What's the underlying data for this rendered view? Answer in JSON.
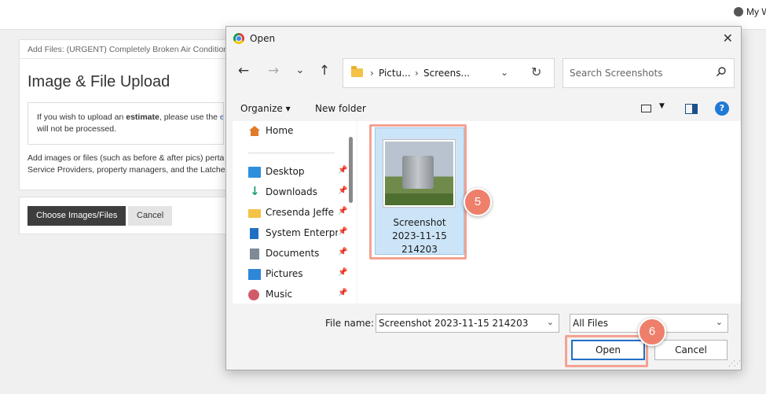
{
  "topbar": {
    "account_label": "My W"
  },
  "page": {
    "breadcrumb": "Add Files: (URGENT) Completely Broken Air Conditioner",
    "title": "Image & File Upload",
    "notice_prefix": "If you wish to upload an ",
    "notice_bold": "estimate",
    "notice_mid": ", please use the ",
    "notice_link": "e",
    "notice_line2": "will not be processed.",
    "help_line1": "Add images or files (such as before & after pics) perta",
    "help_line2": "Service Providers, property managers, and the Latche",
    "choose_button": "Choose Images/Files",
    "cancel_button": "Cancel"
  },
  "dialog": {
    "title": "Open",
    "close_glyph": "✕",
    "nav": {
      "back": "←",
      "forward": "→",
      "recent": "⌄",
      "up": "↑"
    },
    "address": {
      "crumbs": [
        "Pictu...",
        "Screens..."
      ],
      "separator": "›",
      "dropdown": "⌄",
      "refresh": "↻"
    },
    "search_placeholder": "Search Screenshots",
    "toolbar": {
      "organize": "Organize ▾",
      "new_folder": "New folder",
      "help": "?"
    },
    "sidebar": [
      {
        "label": "Home",
        "icon": "home-icon",
        "pinned": false
      },
      {
        "label": "Desktop",
        "icon": "desktop-icon",
        "pinned": true
      },
      {
        "label": "Downloads",
        "icon": "downloads-icon",
        "pinned": true
      },
      {
        "label": "Cresenda Jeffe",
        "icon": "folder-icon",
        "pinned": true
      },
      {
        "label": "System Enterpr",
        "icon": "building-icon",
        "pinned": true
      },
      {
        "label": "Documents",
        "icon": "documents-icon",
        "pinned": true
      },
      {
        "label": "Pictures",
        "icon": "pictures-icon",
        "pinned": true
      },
      {
        "label": "Music",
        "icon": "music-icon",
        "pinned": true
      }
    ],
    "file": {
      "name_line1": "Screenshot",
      "name_line2": "2023-11-15",
      "name_line3": "214203"
    },
    "file_name_label": "File name:",
    "file_name_value": "Screenshot 2023-11-15 214203",
    "file_type": "All Files",
    "open_button": "Open",
    "cancel_button": "Cancel"
  },
  "annotations": {
    "step_5": "5",
    "step_6": "6",
    "highlight_color": "#f4a291",
    "badge_color": "#ee7f6b"
  }
}
